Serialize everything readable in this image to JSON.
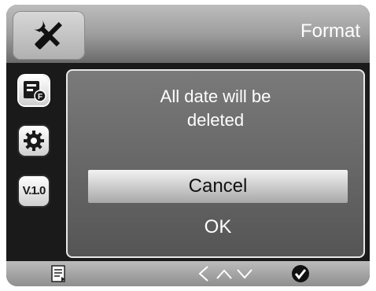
{
  "header": {
    "title": "Format",
    "settings_icon": "tools-icon"
  },
  "sidebar": {
    "items": [
      {
        "icon": "format-card-icon"
      },
      {
        "icon": "gear-icon"
      },
      {
        "icon": "version-icon",
        "label": "V.1.0"
      }
    ]
  },
  "dialog": {
    "message_line1": "All date will be",
    "message_line2": "deleted",
    "options": [
      "Cancel",
      "OK"
    ],
    "selected_option": "Cancel"
  },
  "bottom_bar": {
    "icons": [
      "menu-icon",
      "chevron-left-icon",
      "chevron-up-icon",
      "chevron-down-icon",
      "check-icon"
    ]
  }
}
